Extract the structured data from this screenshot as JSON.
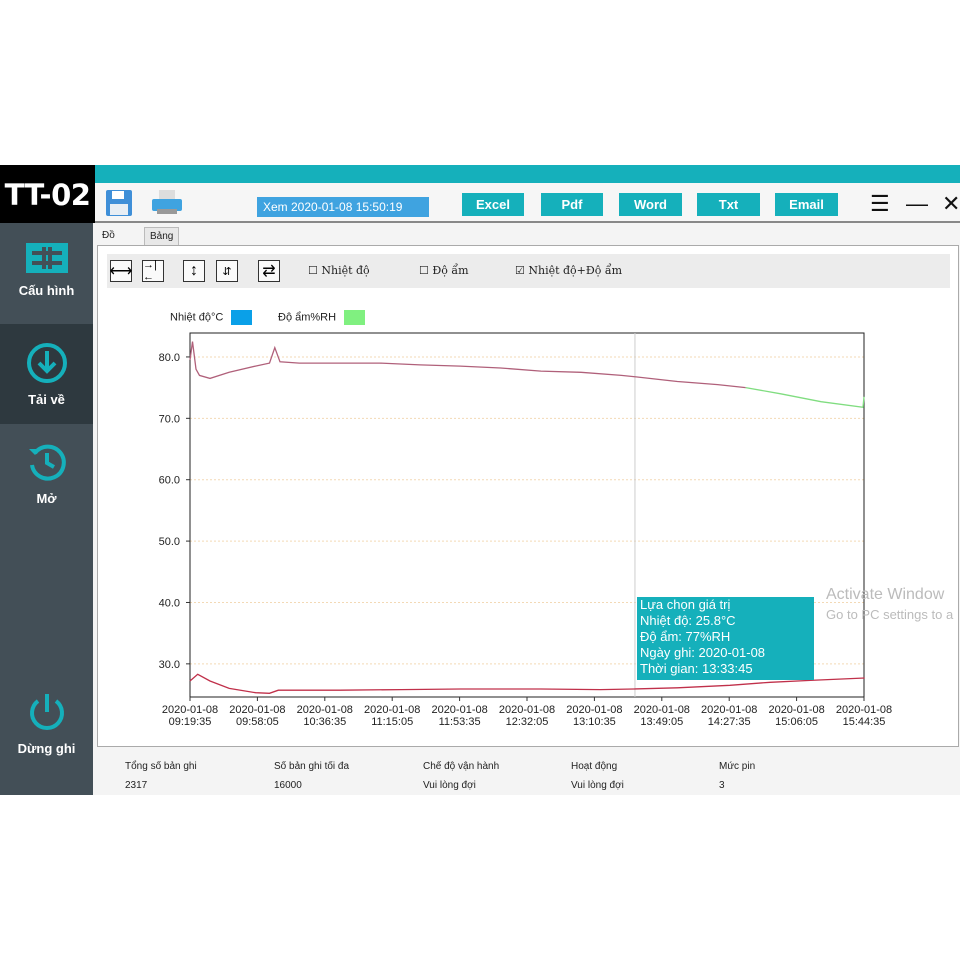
{
  "app": {
    "logo": "TT-02",
    "view_label": "Xem 2020-01-08 15:50:19"
  },
  "sidebar": {
    "items": [
      {
        "label": "Cấu hình",
        "icon": "config-icon"
      },
      {
        "label": "Tải về",
        "icon": "download-icon",
        "active": true
      },
      {
        "label": "Mở",
        "icon": "history-icon"
      },
      {
        "label": "Dừng ghi",
        "icon": "power-icon"
      }
    ]
  },
  "toolbar": {
    "export": [
      "Excel",
      "Pdf",
      "Word",
      "Txt",
      "Email"
    ]
  },
  "tabs": [
    "Đồ thị",
    "Bảng"
  ],
  "chart_toolbar": {
    "checkboxes": [
      {
        "label": "Nhiệt độ",
        "checked": false
      },
      {
        "label": "Độ ẩm",
        "checked": false
      },
      {
        "label": "Nhiệt độ+Độ ẩm",
        "checked": true
      }
    ]
  },
  "legend": [
    {
      "label": "Nhiệt độ°C",
      "color": "#0aa0e8"
    },
    {
      "label": "Độ ẩm%RH",
      "color": "#80f080"
    }
  ],
  "tooltip": {
    "lines": [
      "Lựa chọn giá trị",
      "Nhiệt độ: 25.8°C",
      "Độ ẩm: 77%RH",
      "Ngày ghi: 2020-01-08",
      "Thời gian: 13:33:45"
    ]
  },
  "status": {
    "labels": [
      "Tổng số bản ghi",
      "Số bản ghi tối đa",
      "Chế độ vận hành",
      "Hoạt động",
      "Mức pin"
    ],
    "values": [
      "2317",
      "16000",
      "Vui lòng đợi",
      "Vui lòng đợi",
      "3"
    ]
  },
  "watermark": [
    "Activate Window",
    "Go to PC settings to a"
  ],
  "colors": {
    "accent": "#15b0bb",
    "sidebar": "#434f57"
  },
  "chart_data": {
    "type": "line",
    "xlim": [
      "09:19:35",
      "15:44:35"
    ],
    "ylim": [
      24.6,
      83.9
    ],
    "yticks": [
      "30.0",
      "40.0",
      "50.0",
      "60.0",
      "70.0",
      "80.0"
    ],
    "xticks": [
      [
        "2020-01-08",
        "09:19:35"
      ],
      [
        "2020-01-08",
        "09:58:05"
      ],
      [
        "2020-01-08",
        "10:36:35"
      ],
      [
        "2020-01-08",
        "11:15:05"
      ],
      [
        "2020-01-08",
        "11:53:35"
      ],
      [
        "2020-01-08",
        "12:32:05"
      ],
      [
        "2020-01-08",
        "13:10:35"
      ],
      [
        "2020-01-08",
        "13:49:05"
      ],
      [
        "2020-01-08",
        "14:27:35"
      ],
      [
        "2020-01-08",
        "15:06:05"
      ],
      [
        "2020-01-08",
        "15:44:35"
      ]
    ],
    "cursor_time": "13:33:45",
    "grid": true,
    "series": [
      {
        "color": "#b0607a",
        "points": [
          [
            "09:19:35",
            79.5
          ],
          [
            "09:21",
            82.5
          ],
          [
            "09:23",
            78
          ],
          [
            "09:25",
            77
          ],
          [
            "09:31",
            76.5
          ],
          [
            "09:42",
            77.5
          ],
          [
            "09:57",
            78.5
          ],
          [
            "10:05",
            79
          ],
          [
            "10:08",
            81.5
          ],
          [
            "10:11",
            79.2
          ],
          [
            "10:22",
            79
          ],
          [
            "10:45",
            79
          ],
          [
            "11:08",
            79
          ],
          [
            "11:31",
            78.7
          ],
          [
            "11:54",
            78.5
          ],
          [
            "12:17",
            78.2
          ],
          [
            "12:40",
            77.7
          ],
          [
            "13:03",
            77.5
          ],
          [
            "13:26",
            77
          ],
          [
            "13:33",
            76.8
          ],
          [
            "13:58",
            76
          ],
          [
            "14:21",
            75.5
          ],
          [
            "14:37",
            75
          ]
        ]
      },
      {
        "color": "#80dd80",
        "points": [
          [
            "14:37",
            75
          ],
          [
            "14:57",
            74
          ],
          [
            "15:20",
            72.7
          ],
          [
            "15:44",
            71.8
          ],
          [
            "15:44:35",
            73.5
          ]
        ]
      },
      {
        "color": "#c0304a",
        "points": [
          [
            "09:19:35",
            27.2
          ],
          [
            "09:24",
            28.3
          ],
          [
            "09:31",
            27.2
          ],
          [
            "09:42",
            26
          ],
          [
            "09:57",
            25.3
          ],
          [
            "10:05",
            25.2
          ],
          [
            "10:10",
            25.7
          ],
          [
            "10:45",
            25.7
          ],
          [
            "11:20",
            25.8
          ],
          [
            "11:54",
            25.9
          ],
          [
            "12:40",
            25.9
          ],
          [
            "13:14",
            25.8
          ],
          [
            "13:33",
            25.9
          ],
          [
            "13:58",
            26.1
          ],
          [
            "14:28",
            26.5
          ],
          [
            "14:51",
            27
          ],
          [
            "15:14",
            27.3
          ],
          [
            "15:45",
            27.7
          ]
        ]
      }
    ]
  }
}
